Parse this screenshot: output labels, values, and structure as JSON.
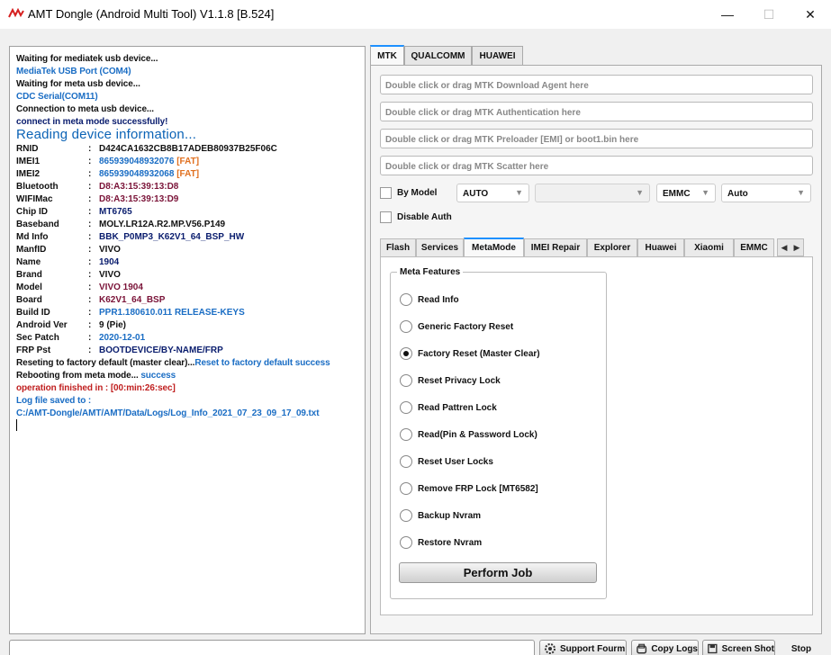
{
  "window": {
    "title": "AMT Dongle (Android Multi Tool) V1.1.8 [B.524]",
    "minimize": "—",
    "maximize": "☐",
    "close": "✕"
  },
  "log": {
    "lines": [
      {
        "text": "Waiting for mediatek usb device...",
        "color": "black"
      },
      {
        "text": "MediaTek USB Port (COM4)",
        "color": "blue"
      },
      {
        "text": "Waiting for meta usb device...",
        "color": "black"
      },
      {
        "text": "CDC Serial(COM11)",
        "color": "blue"
      },
      {
        "text": "Connection to meta usb device...",
        "color": "black"
      },
      {
        "text": "connect in meta mode successfully!",
        "color": "navy"
      }
    ],
    "heading": "Reading device information...",
    "fields": [
      {
        "key": "RNID",
        "value": "D424CA1632CB8B17ADEB80937B25F06C",
        "color": "black",
        "tag": ""
      },
      {
        "key": "IMEI1",
        "value": "865939048932076",
        "color": "blue",
        "tag": "[FAT]"
      },
      {
        "key": "IMEI2",
        "value": "865939048932068",
        "color": "blue",
        "tag": "[FAT]"
      },
      {
        "key": "Bluetooth",
        "value": "D8:A3:15:39:13:D8",
        "color": "wine",
        "tag": ""
      },
      {
        "key": "WIFIMac",
        "value": "D8:A3:15:39:13:D9",
        "color": "wine",
        "tag": ""
      },
      {
        "key": "Chip ID",
        "value": "MT6765",
        "color": "navy",
        "tag": ""
      },
      {
        "key": "Baseband",
        "value": "MOLY.LR12A.R2.MP.V56.P149",
        "color": "black",
        "tag": ""
      },
      {
        "key": "Md Info",
        "value": "BBK_P0MP3_K62V1_64_BSP_HW",
        "color": "navy",
        "tag": ""
      },
      {
        "key": "ManfID",
        "value": "VIVO",
        "color": "black",
        "tag": ""
      },
      {
        "key": "Name",
        "value": "1904",
        "color": "navy",
        "tag": ""
      },
      {
        "key": "Brand",
        "value": "VIVO",
        "color": "black",
        "tag": ""
      },
      {
        "key": "Model",
        "value": "VIVO 1904",
        "color": "wine",
        "tag": ""
      },
      {
        "key": "Board",
        "value": "K62V1_64_BSP",
        "color": "wine",
        "tag": ""
      },
      {
        "key": "Build ID",
        "value": "PPR1.180610.011 RELEASE-KEYS",
        "color": "blue",
        "tag": ""
      },
      {
        "key": "Android Ver",
        "value": "9 (Pie)",
        "color": "black",
        "tag": ""
      },
      {
        "key": "Sec Patch",
        "value": "2020-12-01",
        "color": "blue",
        "tag": ""
      },
      {
        "key": "FRP Pst",
        "value": "BOOTDEVICE/BY-NAME/FRP",
        "color": "navy",
        "tag": ""
      }
    ],
    "reset_line": "Reseting to factory default (master clear)...",
    "reset_result": "Reset to factory default success",
    "reboot_line": "Rebooting from meta mode...",
    "reboot_result": " success",
    "finished": "operation finished in : [00:min:26:sec]",
    "saved_label": "Log file saved to :",
    "saved_path": "C:/AMT-Dongle/AMT/AMT/Data/Logs/Log_Info_2021_07_23_09_17_09.txt"
  },
  "top_tabs": [
    "MTK",
    "QUALCOMM",
    "HUAWEI"
  ],
  "fields": {
    "download_agent": "Double click or drag MTK Download Agent here",
    "auth": "Double click or drag MTK Authentication here",
    "preloader": "Double click or drag MTK Preloader [EMI] or boot1.bin here",
    "scatter": "Double click or drag MTK Scatter here"
  },
  "options": {
    "by_model": "By Model",
    "mode": "AUTO",
    "model": "",
    "storage": "EMMC",
    "auto": "Auto",
    "disable_auth": "Disable Auth"
  },
  "sub_tabs": [
    "Flash",
    "Services",
    "MetaMode",
    "IMEI Repair",
    "Explorer",
    "Huawei",
    "Xiaomi",
    "EMMC"
  ],
  "meta": {
    "title": "Meta Features",
    "items": [
      "Read Info",
      "Generic Factory Reset",
      "Factory Reset (Master Clear)",
      "Reset Privacy Lock",
      "Read Pattren Lock",
      "Read(Pin & Password Lock)",
      "Reset User Locks",
      "Remove FRP Lock [MT6582]",
      "Backup Nvram",
      "Restore Nvram"
    ],
    "selected": 2,
    "perform": "Perform Job"
  },
  "bottom": {
    "progress": 0,
    "support": "Support Fourm",
    "copy": "Copy Logs",
    "screenshot": "Screen Shot",
    "stop": "Stop"
  },
  "colors": {
    "accent": "#1e90ff",
    "blue": "#1a6dc4",
    "navy": "#0a1d6e",
    "wine": "#7a1338",
    "orange": "#e07020"
  }
}
